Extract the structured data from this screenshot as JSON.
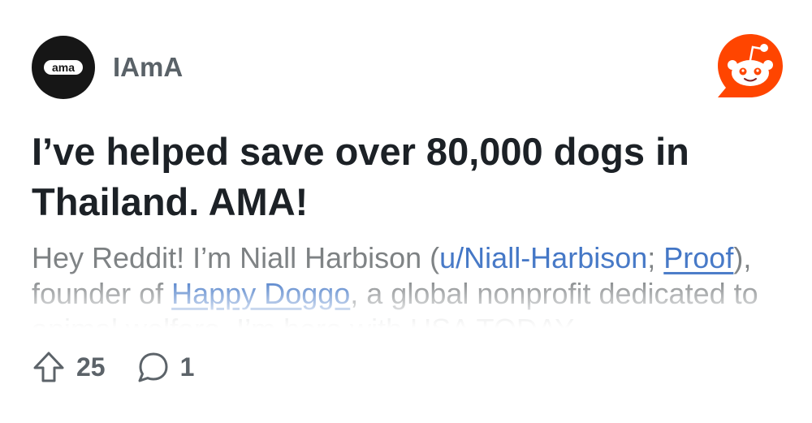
{
  "subreddit": {
    "name": "IAmA",
    "avatar_icon": "ama-logo-icon",
    "avatar_color": "#161616"
  },
  "brand": {
    "logo": "reddit-snoo-icon",
    "color": "#ff4500"
  },
  "post": {
    "title": "I’ve helped save over 80,000 dogs in Thailand. AMA!",
    "body": {
      "t1": "Hey Reddit! I’m Niall Harbison (",
      "link_user": "u/Niall-Harbison",
      "t2": "; ",
      "link_proof": "Proof",
      "t3": "), founder of ",
      "link_org": "Happy Doggo",
      "t4": ", a global nonprofit dedicated to animal welfare. I’m here with USA TODAY"
    },
    "link_color": "#3d72c4"
  },
  "footer": {
    "upvotes": "25",
    "upvote_icon": "upvote-arrow-icon",
    "comments": "1",
    "comment_icon": "comment-bubble-icon"
  }
}
